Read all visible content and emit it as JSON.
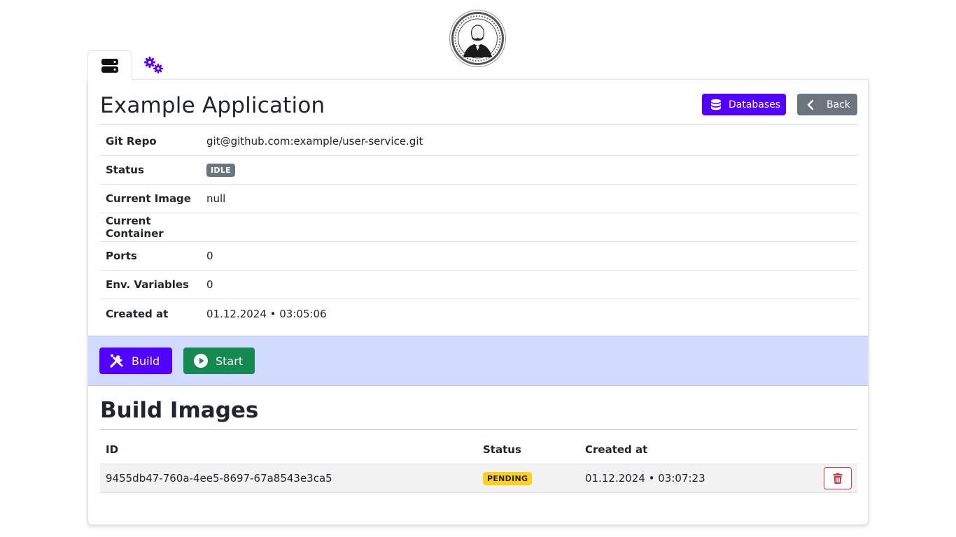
{
  "logo": {
    "alt": "mustache-gentleman-logo"
  },
  "tabs": [
    {
      "icon": "server-icon",
      "active": true
    },
    {
      "icon": "gears-icon",
      "active": false
    }
  ],
  "app": {
    "title": "Example Application",
    "databases_label": "Databases",
    "back_label": "Back"
  },
  "details": [
    {
      "label": "Git Repo",
      "value": "git@github.com:example/user-service.git"
    },
    {
      "label": "Status",
      "value": "IDLE"
    },
    {
      "label": "Current Image",
      "value": "null"
    },
    {
      "label": "Current Container",
      "value": ""
    },
    {
      "label": "Ports",
      "value": "0"
    },
    {
      "label": "Env. Variables",
      "value": "0"
    },
    {
      "label": "Created at",
      "value": "01.12.2024 • 03:05:06"
    }
  ],
  "actions": {
    "build_label": "Build",
    "start_label": "Start"
  },
  "build_images": {
    "title": "Build Images",
    "columns": [
      "ID",
      "Status",
      "Created at"
    ],
    "rows": [
      {
        "id": "9455db47-760a-4ee5-8697-67a8543e3ca5",
        "status": "PENDING",
        "created_at": "01.12.2024 • 03:07:23"
      }
    ]
  },
  "colors": {
    "primary": "#5200ff",
    "secondary": "#6c757d",
    "success": "#148a50",
    "danger": "#dc3545",
    "warning": "#ffd11a",
    "actions_bg": "#d1dbff"
  }
}
